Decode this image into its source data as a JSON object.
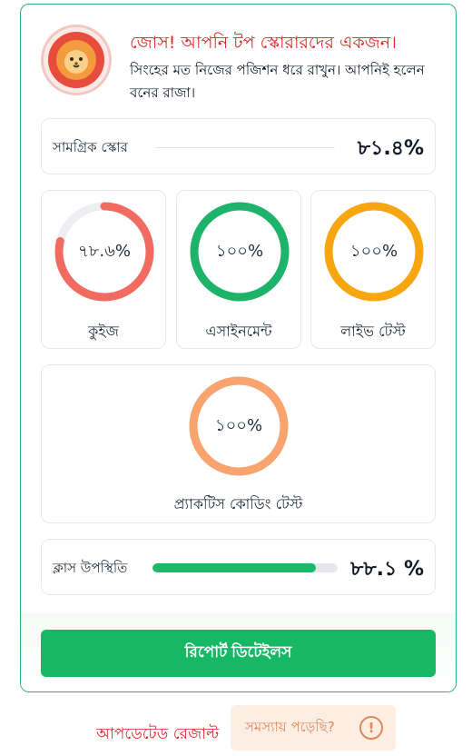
{
  "header": {
    "headline": "জোস! আপনি টপ স্কোরারদের একজন।",
    "subline": "সিংহের মত নিজের পজিশন ধরে রাখুন। আপনিই হলেন বনের রাজা।",
    "avatar_icon": "lion-icon"
  },
  "overall": {
    "label": "সামগ্রিক স্কোর",
    "value": "৮১.৪%"
  },
  "metrics": [
    {
      "label": "কুইজ",
      "value_text": "৭৮.৬%",
      "percent": 78.6,
      "color": "#f26b61"
    },
    {
      "label": "এসাইনমেন্ট",
      "value_text": "১০০%",
      "percent": 100,
      "color": "#1db36a"
    },
    {
      "label": "লাইভ টেস্ট",
      "value_text": "১০০%",
      "percent": 100,
      "color": "#f7a60f"
    }
  ],
  "practice": {
    "label": "প্র্যাকটিস কোডিং টেস্ট",
    "value_text": "১০০%",
    "percent": 100,
    "color": "#f9a36e"
  },
  "attendance": {
    "label": "ক্লাস উপস্থিতি",
    "value": "৮৮.১ %",
    "percent": 88.1
  },
  "buttons": {
    "report": "রিপোর্ট ডিটেইলস"
  },
  "footer": {
    "updated": "আপডেটেড রেজাল্ট",
    "help": "সমস্যায় পড়েছি?",
    "help_icon": "!"
  },
  "colors": {
    "accent": "#16b865",
    "danger": "#dc2626",
    "track": "#e5e7eb"
  }
}
